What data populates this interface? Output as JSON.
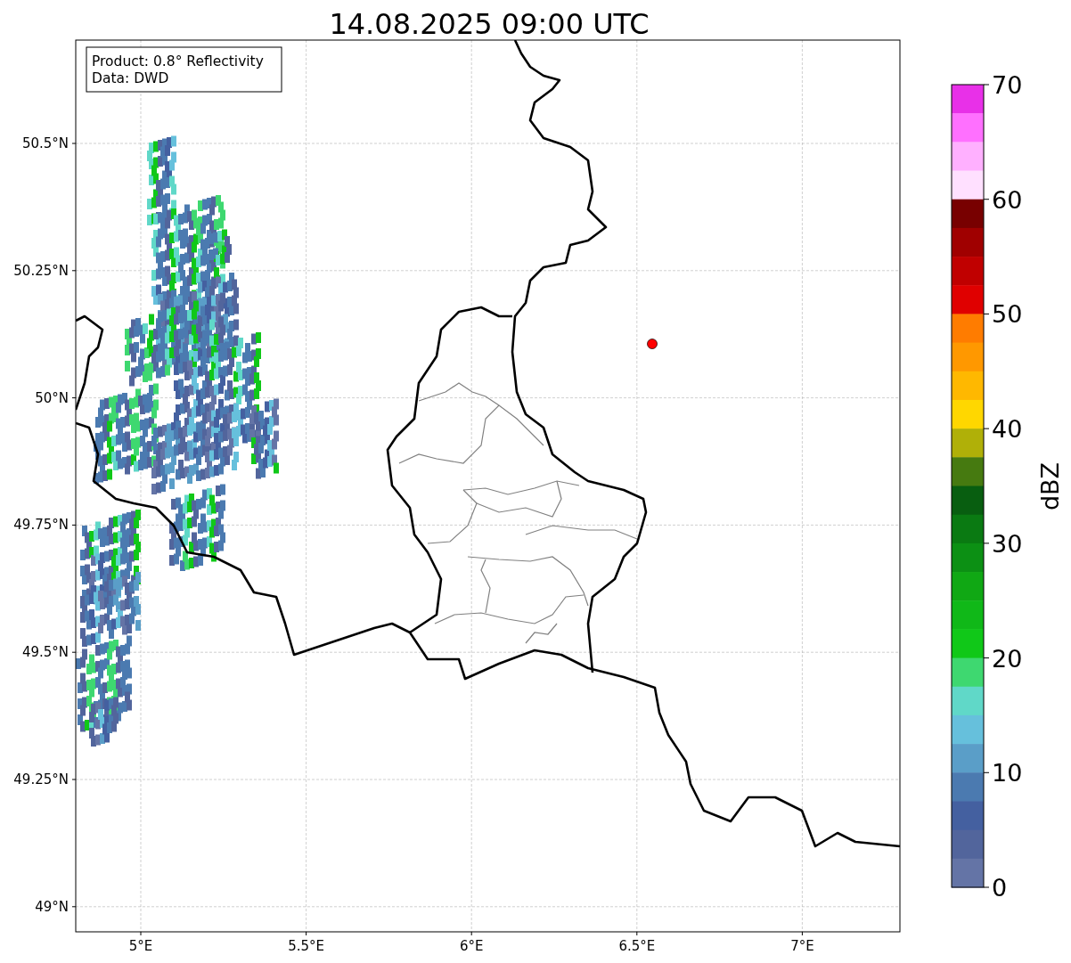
{
  "title": "14.08.2025 09:00 UTC",
  "legend": [
    "Product: 0.8° Reflectivity",
    "Data: DWD"
  ],
  "map": {
    "lon_ticks": [
      "5°E",
      "5.5°E",
      "6°E",
      "6.5°E",
      "7°E"
    ],
    "lat_ticks": [
      "50.5°N",
      "50.25°N",
      "50°N",
      "49.75°N",
      "49.5°N",
      "49.25°N",
      "49°N"
    ]
  },
  "colorbar": {
    "label": "dBZ",
    "ticks": [
      "70",
      "60",
      "50",
      "40",
      "30",
      "20",
      "10",
      "0"
    ],
    "bins": [
      {
        "color": "#e830e8"
      },
      {
        "color": "#ff70ff"
      },
      {
        "color": "#ffb0ff"
      },
      {
        "color": "#ffe0ff"
      },
      {
        "color": "#780000"
      },
      {
        "color": "#a00000"
      },
      {
        "color": "#c00000"
      },
      {
        "color": "#e00000"
      },
      {
        "color": "#ff7c00"
      },
      {
        "color": "#ff9800"
      },
      {
        "color": "#ffb800"
      },
      {
        "color": "#ffd700"
      },
      {
        "color": "#b0b008"
      },
      {
        "color": "#467a10"
      },
      {
        "color": "#085e10"
      },
      {
        "color": "#0a7a12"
      },
      {
        "color": "#0c9014"
      },
      {
        "color": "#10a814"
      },
      {
        "color": "#10b818"
      },
      {
        "color": "#10c818"
      },
      {
        "color": "#3ed870"
      },
      {
        "color": "#60d8c8"
      },
      {
        "color": "#66c0dc"
      },
      {
        "color": "#5a9ec8"
      },
      {
        "color": "#4b7ab0"
      },
      {
        "color": "#4460a0"
      },
      {
        "color": "#52659c"
      },
      {
        "color": "#6474a6"
      }
    ]
  }
}
